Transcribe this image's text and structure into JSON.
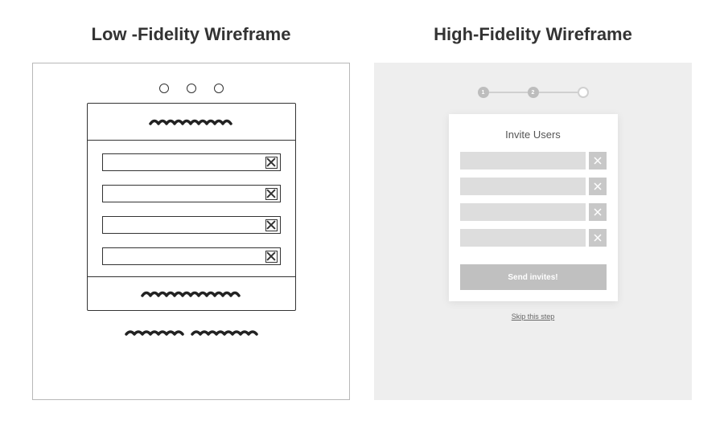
{
  "leftTitle": "Low -Fidelity Wireframe",
  "rightTitle": "High-Fidelity Wireframe",
  "hifi": {
    "step1": "1",
    "step2": "2",
    "cardTitle": "Invite Users",
    "buttonLabel": "Send invites!",
    "skipLabel": "Skip this step"
  }
}
